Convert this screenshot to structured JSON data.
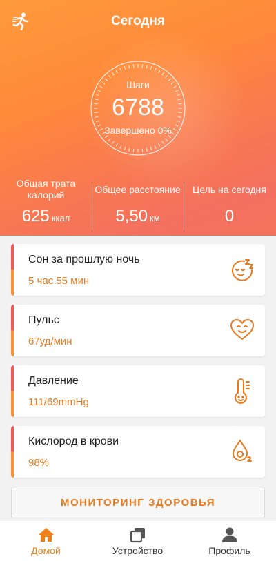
{
  "header": {
    "title": "Сегодня",
    "icon": "running-man-icon"
  },
  "steps": {
    "label": "Шаги",
    "value": "6788",
    "completed": "Завершено 0%",
    "progress_fraction": 0.0
  },
  "stats": [
    {
      "label": "Общая трата калорий",
      "value": "625",
      "unit": "ккал"
    },
    {
      "label": "Общее расстояние",
      "value": "5,50",
      "unit": "км"
    },
    {
      "label": "Цель на сегодня",
      "value": "0",
      "unit": ""
    }
  ],
  "cards": [
    {
      "title": "Сон за прошлую ночь",
      "value": "5 час 55 мин",
      "icon": "sleep-face-icon"
    },
    {
      "title": "Пульс",
      "value": "67уд/мин",
      "icon": "heart-face-icon"
    },
    {
      "title": "Давление",
      "value": "111/69mmHg",
      "icon": "thermometer-face-icon"
    },
    {
      "title": "Кислород в крови",
      "value": "98%",
      "icon": "oxygen-drop-icon"
    }
  ],
  "monitor_button": "МОНИТОРИНГ ЗДОРОВЬЯ",
  "tabs": [
    {
      "label": "Домой",
      "icon": "home-icon",
      "active": true
    },
    {
      "label": "Устройство",
      "icon": "device-icon",
      "active": false
    },
    {
      "label": "Профиль",
      "icon": "profile-icon",
      "active": false
    }
  ],
  "colors": {
    "accent": "#e77a1d",
    "hero_orange": "#ff9a3c",
    "hero_red": "#f2735b",
    "card_bar_red": "#ef5a5a",
    "card_bar_orange": "#f7923a"
  }
}
